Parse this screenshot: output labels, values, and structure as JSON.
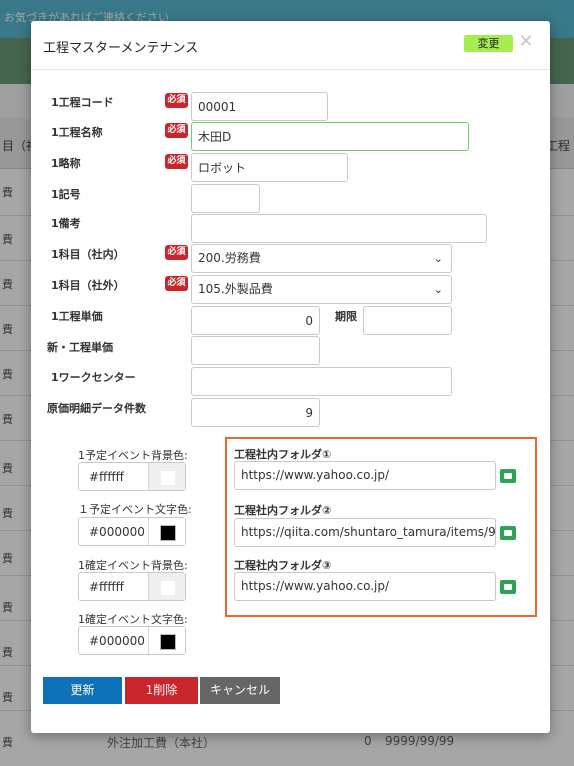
{
  "background": {
    "notice": "お気づきがあればご連絡ください",
    "header_left": "目（社",
    "header_right": "工程",
    "row_text": "費",
    "footer": {
      "name": "外注加工費（本社）",
      "num": "0",
      "date": "9999/99/99"
    }
  },
  "modal": {
    "title": "工程マスターメンテナンス",
    "change_label": "変更",
    "close_glyph": "✕",
    "required_label": "必須",
    "fields": {
      "code": {
        "label": "1工程コード",
        "value": "00001"
      },
      "name": {
        "label": "1工程名称",
        "value": "木田D"
      },
      "short": {
        "label": "1略称",
        "value": "ロボット"
      },
      "symbol": {
        "label": "1記号",
        "value": ""
      },
      "note": {
        "label": "1備考",
        "value": ""
      },
      "subject_in": {
        "label": "1科目（社内）",
        "value": "200.労務費"
      },
      "subject_out": {
        "label": "1科目（社外）",
        "value": "105.外製品費"
      },
      "unit_price": {
        "label": "1工程単価",
        "value": "0"
      },
      "period": {
        "label": "期限",
        "value": ""
      },
      "new_unit_price": {
        "label": "新・工程単価",
        "value": ""
      },
      "workcenter": {
        "label": "1ワークセンター",
        "value": ""
      },
      "cost_count": {
        "label": "原価明細データ件数",
        "value": "9"
      }
    },
    "colors": [
      {
        "label": "1予定イベント背景色:",
        "value": "#ffffff",
        "swatch": "#ffffff"
      },
      {
        "label": "１予定イベント文字色:",
        "value": "#000000",
        "swatch": "#000000"
      },
      {
        "label": "1確定イベント背景色:",
        "value": "#ffffff",
        "swatch": "#ffffff"
      },
      {
        "label": "1確定イベント文字色:",
        "value": "#000000",
        "swatch": "#000000"
      }
    ],
    "folders": [
      {
        "label": "工程社内フォルダ①",
        "value": "https://www.yahoo.co.jp/"
      },
      {
        "label": "工程社内フォルダ②",
        "value": "https://qiita.com/shuntaro_tamura/items/9"
      },
      {
        "label": "工程社内フォルダ③",
        "value": "https://www.yahoo.co.jp/"
      }
    ],
    "buttons": {
      "update": "更新",
      "delete": "1削除",
      "cancel": "キャンセル"
    },
    "accent_colors": {
      "primary": "#0f72b8",
      "danger": "#c9252c",
      "folder_frame": "#e8672a",
      "change_button": "#a6ee50",
      "folder_icon": "#2aa552"
    }
  }
}
